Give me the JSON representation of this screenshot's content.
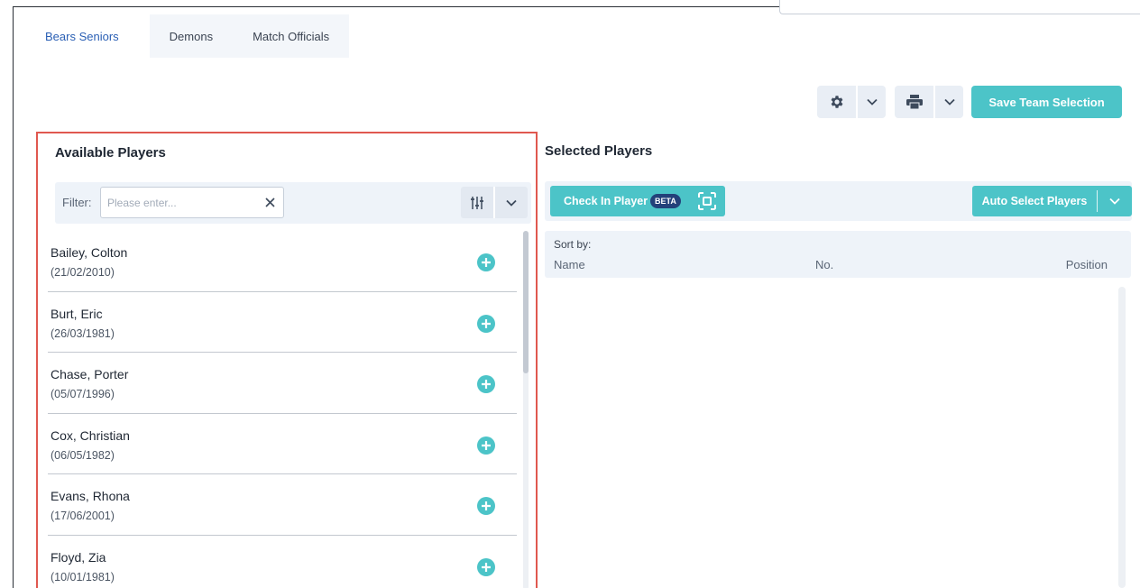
{
  "tabs": [
    {
      "label": "Bears Seniors",
      "active": true
    },
    {
      "label": "Demons",
      "active": false
    },
    {
      "label": "Match Officials",
      "active": false
    }
  ],
  "toolbar": {
    "settings_icon": "gear-icon",
    "print_icon": "printer-icon",
    "save_label": "Save Team Selection"
  },
  "available": {
    "title": "Available Players",
    "filter_label": "Filter:",
    "filter_placeholder": "Please enter...",
    "filter_value": "",
    "players": [
      {
        "name": "Bailey, Colton",
        "dob": "(21/02/2010)"
      },
      {
        "name": "Burt, Eric",
        "dob": "(26/03/1981)"
      },
      {
        "name": "Chase, Porter",
        "dob": "(05/07/1996)"
      },
      {
        "name": "Cox, Christian",
        "dob": "(06/05/1982)"
      },
      {
        "name": "Evans, Rhona",
        "dob": "(17/06/2001)"
      },
      {
        "name": "Floyd, Zia",
        "dob": "(10/01/1981)"
      }
    ]
  },
  "selected": {
    "title": "Selected Players",
    "checkin_label": "Check In Player",
    "beta_badge": "BETA",
    "auto_select_label": "Auto Select Players",
    "sort_label": "Sort by:",
    "columns": {
      "name": "Name",
      "number": "No.",
      "position": "Position"
    }
  },
  "colors": {
    "accent": "#4cc4c8",
    "tab_active_text": "#2a5fb4",
    "highlight_border": "#e0584f",
    "badge": "#23417a"
  }
}
